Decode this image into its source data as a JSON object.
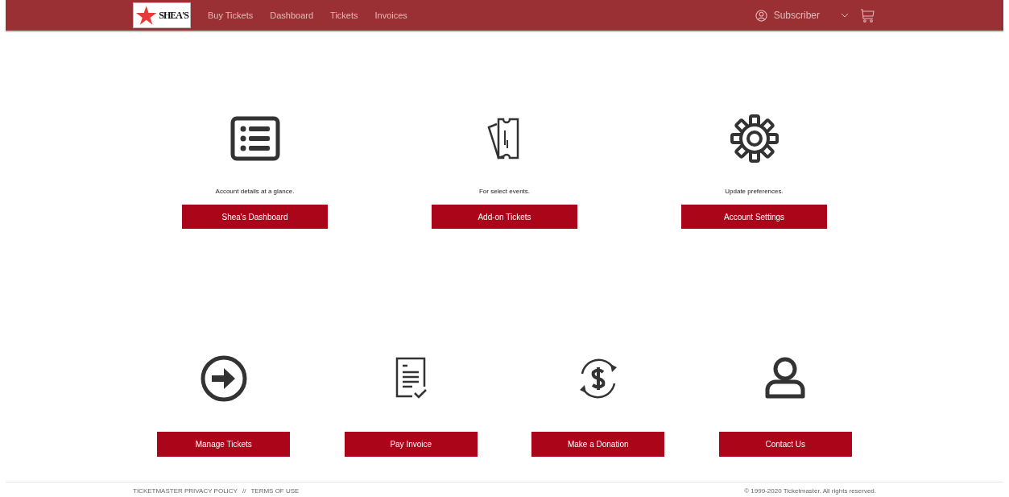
{
  "nav": {
    "logo_text": "SHEA'S",
    "links": [
      "Buy Tickets",
      "Dashboard",
      "Tickets",
      "Invoices"
    ],
    "account": "Subscriber"
  },
  "top_tiles": [
    {
      "kind": "list",
      "description": "Account details at a glance.",
      "button": "Shea's Dashboard"
    },
    {
      "kind": "ticket",
      "description": "For select events.",
      "button": "Add-on Tickets"
    },
    {
      "kind": "gear",
      "description": "Update preferences.",
      "button": "Account Settings"
    }
  ],
  "bottom_tiles": [
    {
      "kind": "arrow",
      "button": "Manage Tickets"
    },
    {
      "kind": "invoice",
      "button": "Pay Invoice"
    },
    {
      "kind": "donation",
      "button": "Make a Donation"
    },
    {
      "kind": "person",
      "button": "Contact Us"
    }
  ],
  "footer": {
    "links": [
      "TICKETMASTER PRIVACY POLICY",
      "TERMS OF USE"
    ],
    "separator": "//",
    "copyright": "© 1999-2020 Ticketmaster. All rights reserved."
  }
}
